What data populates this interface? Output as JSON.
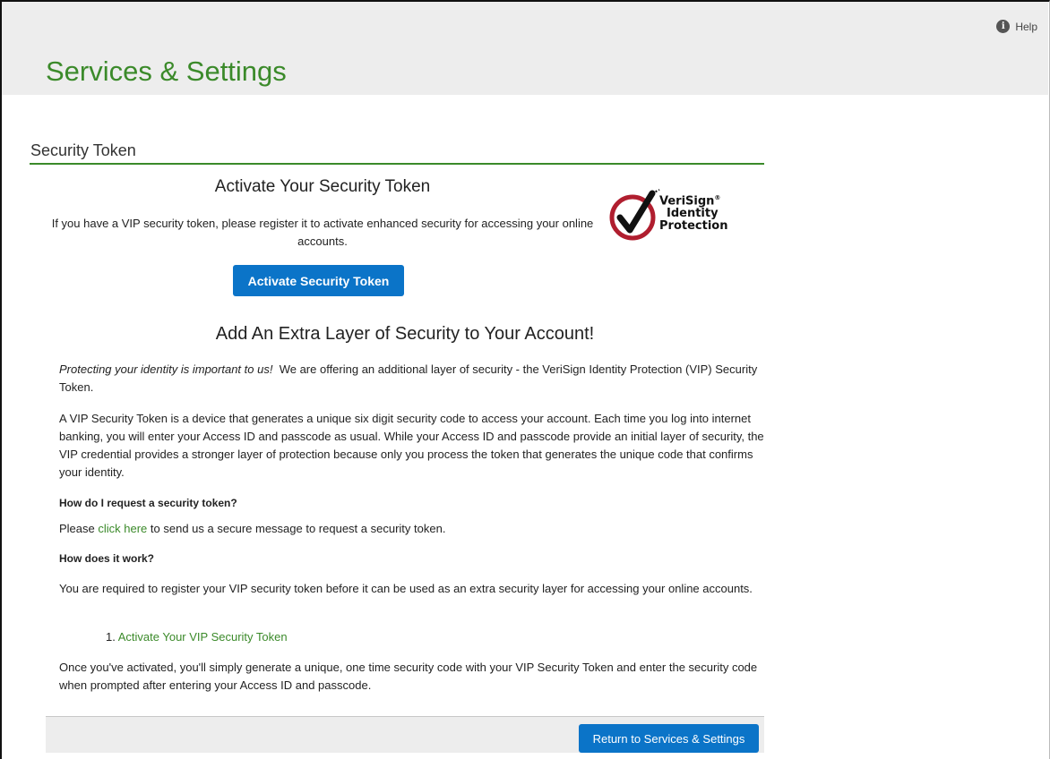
{
  "header": {
    "help_label": "Help",
    "title": "Services & Settings"
  },
  "section": {
    "title": "Security Token"
  },
  "activate": {
    "heading": "Activate Your Security Token",
    "intro": "If you have a VIP security token, please register it to activate enhanced security for accessing your online accounts.",
    "button_label": "Activate Security Token"
  },
  "logo": {
    "line1": "VeriSign",
    "line2": "Identity",
    "line3": "Protection",
    "mark": "®"
  },
  "extra": {
    "heading": "Add An Extra Layer of Security to Your Account!",
    "para1_em": "Protecting your identity is important to us!",
    "para1_rest": "We are offering an additional layer of security - the VeriSign Identity Protection (VIP) Security Token.",
    "para2": "A VIP Security Token is a device that generates a unique six digit security code to access your account. Each time you log into internet banking, you will enter your Access ID and passcode as usual. While your Access ID and passcode provide an initial layer of security, the VIP credential provides a stronger layer of protection because only you process the token that generates the unique code that confirms your identity.",
    "q1": "How do I request a security token?",
    "a1_prefix": "Please",
    "a1_link": "click here",
    "a1_suffix": "to send us a secure message to request a security token.",
    "q2": "How does it work?",
    "a2": "You are required to register your VIP security token before it can be used as an extra security layer for accessing your online accounts.",
    "step_number": "1.",
    "step_link": "Activate Your VIP Security Token",
    "closing": "Once you've activated, you'll simply generate a unique, one time security code with your VIP Security Token and enter the security code when prompted after entering your Access ID and passcode."
  },
  "footer": {
    "return_label": "Return to Services & Settings"
  },
  "colors": {
    "brand_green": "#3b8a2a",
    "button_blue": "#0b74c8",
    "logo_red": "#b01e2f"
  }
}
